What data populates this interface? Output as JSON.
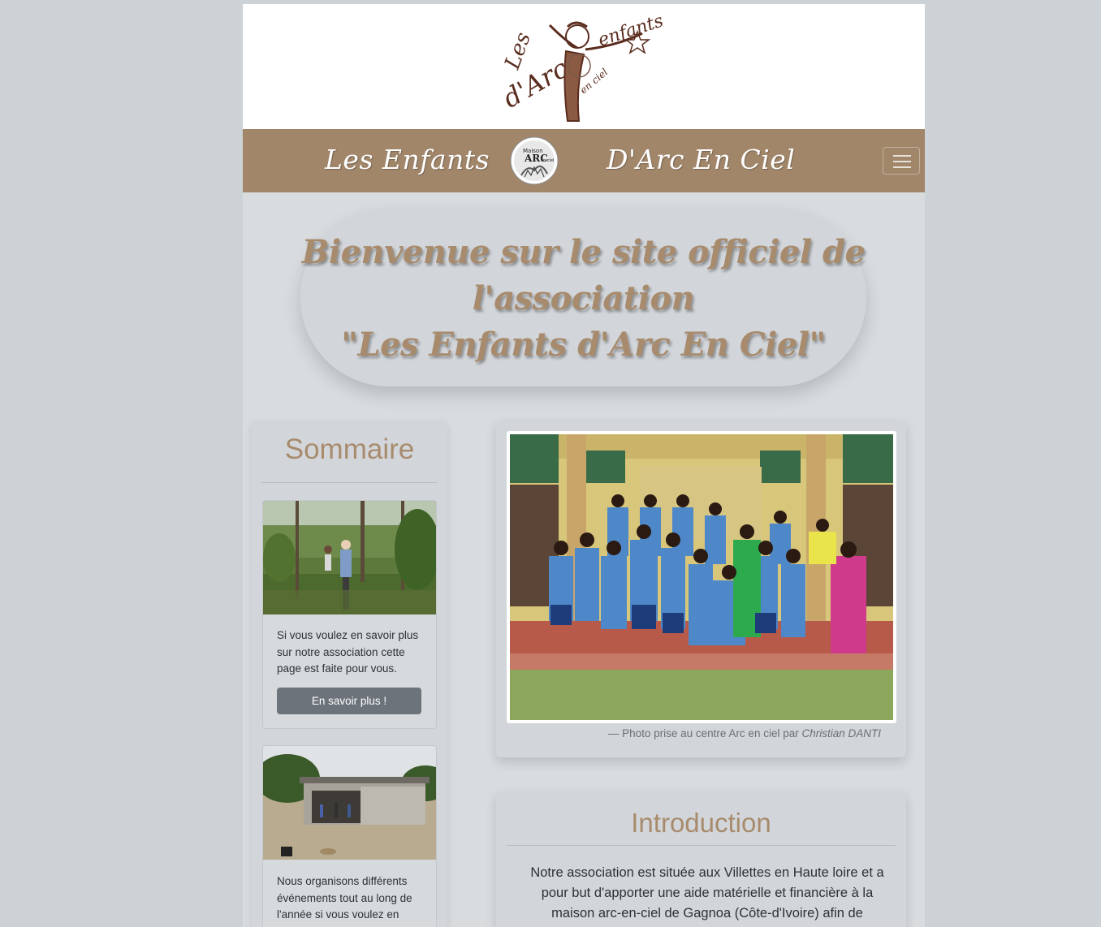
{
  "header": {
    "logo_text": [
      "Les",
      "enfants",
      "d'Arc",
      "en ciel"
    ],
    "brand_left": "Les Enfants",
    "brand_right": "D'Arc En Ciel",
    "nav_logo_text": [
      "Maison",
      "ARC",
      "en ciel"
    ]
  },
  "welcome": {
    "line1": "Bienvenue sur le site officiel de",
    "line2": "l'association",
    "line3": "\"Les Enfants d'Arc En Ciel\""
  },
  "sidebar": {
    "title": "Sommaire",
    "cards": [
      {
        "text": "Si vous voulez en savoir plus sur notre association cette page est faite pour vous.",
        "button_label": "En savoir plus !"
      },
      {
        "text": "Nous organisons différents événements tout au long de l'année si vous voulez en"
      }
    ]
  },
  "photo": {
    "caption_prefix": "— Photo prise au centre Arc en ciel par ",
    "caption_author": "Christian DANTI"
  },
  "intro": {
    "title": "Introduction",
    "text": "Notre association est située aux Villettes en Haute loire et a pour but d'apporter une aide matérielle et financière à la maison arc-en-ciel de Gagnoa (Côte-d'Ivoire) afin de"
  },
  "colors": {
    "accent": "#a88b6d",
    "navbar": "#a1866a",
    "button": "#6c737b",
    "page_bg": "#d8dcdf"
  }
}
